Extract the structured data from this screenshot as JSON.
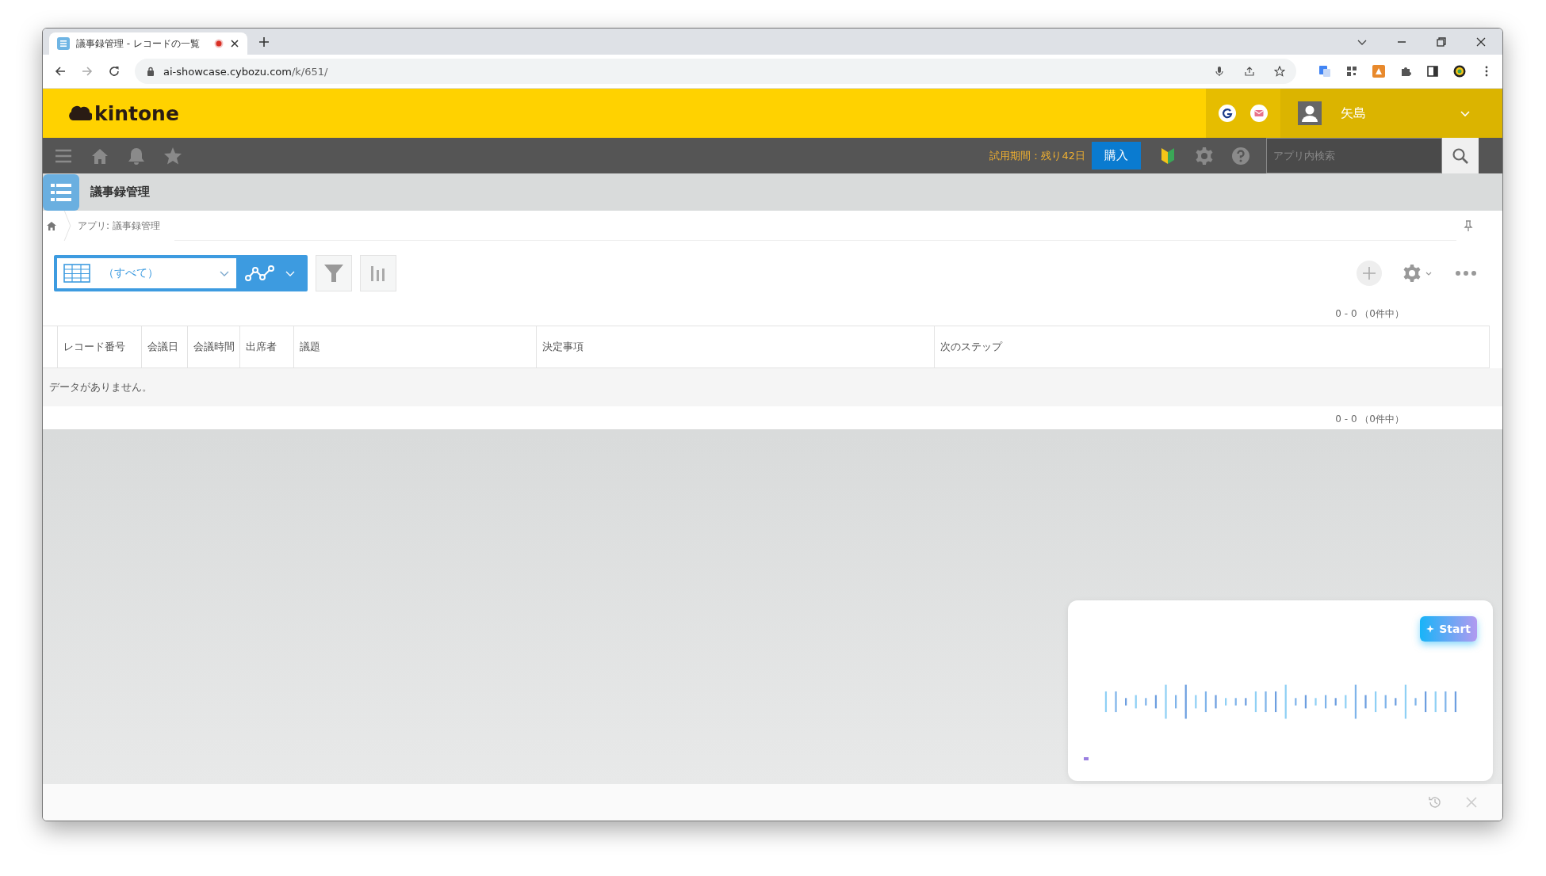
{
  "browser": {
    "tab_title": "議事録管理 - レコードの一覧",
    "url_host": "ai-showcase.cybozu.com",
    "url_path": "/k/651/"
  },
  "header": {
    "logo": "kintone",
    "user": "矢島"
  },
  "nav": {
    "trial": "試用期間：残り42日",
    "buy": "購入",
    "search": {
      "placeholder": "アプリ内検索"
    }
  },
  "app": {
    "title": "議事録管理",
    "breadcrumb": "アプリ: 議事録管理"
  },
  "toolbar": {
    "view": "（すべて）"
  },
  "pager_top": "0 - 0 （0件中）",
  "table": {
    "columns": [
      "レコード番号",
      "会議日",
      "会議時間",
      "出席者",
      "議題",
      "決定事項",
      "次のステップ"
    ],
    "empty": "データがありません。"
  },
  "pager_bottom": "0 - 0 （0件中）",
  "widget": {
    "button": "Start"
  }
}
